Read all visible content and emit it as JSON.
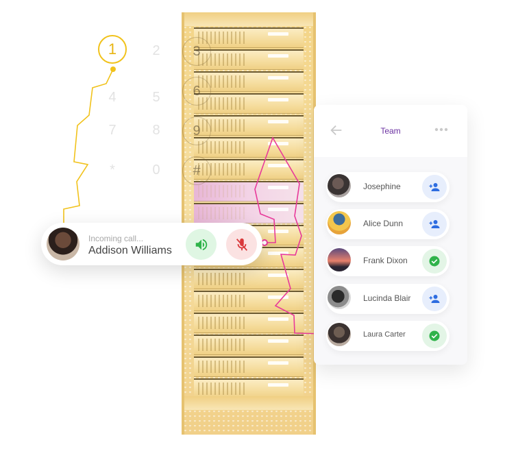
{
  "step_marker": {
    "label": "1"
  },
  "dial_keypad": {
    "faint_digits": [
      "2",
      "4",
      "5",
      "7",
      "8",
      "0",
      "*"
    ],
    "highlighted_digits": [
      "3",
      "6",
      "9",
      "#"
    ]
  },
  "call_card": {
    "status": "Incoming call...",
    "caller_name": "Addison Williams",
    "speaker_icon": "speaker-icon",
    "mute_icon": "mic-off-icon"
  },
  "team_panel": {
    "title": "Team",
    "back_icon": "arrow-left-icon",
    "more_icon": "more-horizontal-icon",
    "members": [
      {
        "name": "Josephine",
        "action": "add-user-icon"
      },
      {
        "name": "Alice Dunn",
        "action": "add-user-icon"
      },
      {
        "name": "Frank Dixon",
        "action": "check-icon"
      },
      {
        "name": "Lucinda Blair",
        "action": "add-user-icon"
      },
      {
        "name": "Laura Carter",
        "action": "check-icon"
      }
    ]
  },
  "colors": {
    "accent_yellow": "#f1c21b",
    "accent_pink": "#e8399a",
    "team_title": "#6a2fa0",
    "add_blue": "#2d6ce0",
    "check_green": "#2fb34a",
    "speaker_green": "#2fb34a",
    "mute_red": "#d9383a"
  }
}
